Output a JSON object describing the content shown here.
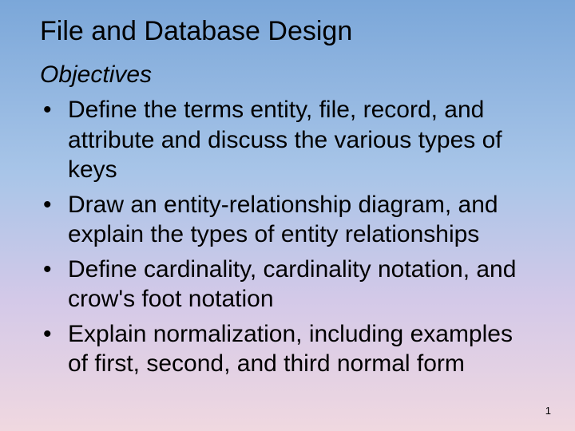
{
  "title": "File and Database Design",
  "subtitle": "Objectives",
  "bullets": [
    "Define the terms entity, file, record, and attribute and discuss the various types of keys",
    "Draw an entity-relationship diagram, and explain the types of entity relationships",
    "Define cardinality, cardinality notation, and crow's foot notation",
    "Explain normalization, including examples of first, second, and third normal form"
  ],
  "pageNumber": "1"
}
